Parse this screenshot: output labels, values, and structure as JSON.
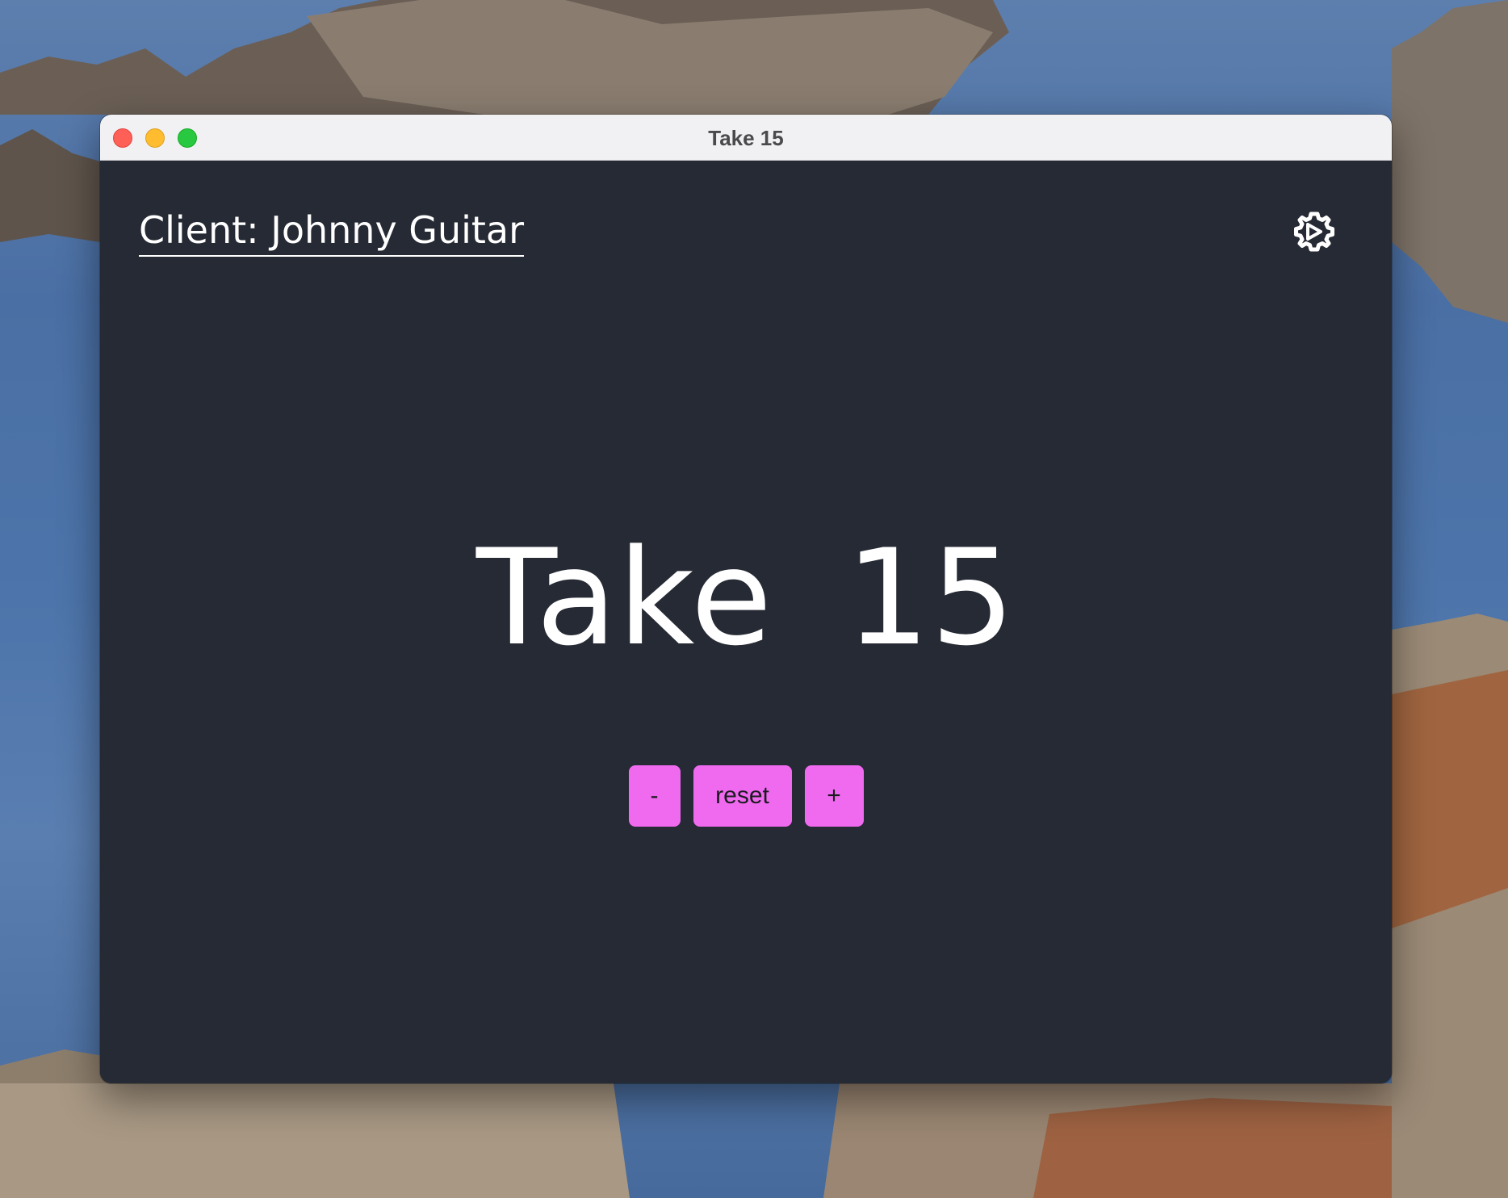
{
  "window": {
    "title": "Take 15"
  },
  "header": {
    "client_label": "Client: Johnny Guitar",
    "settings_icon": "gear-icon"
  },
  "display": {
    "take_word": "Take",
    "take_number": "15"
  },
  "controls": {
    "decrement_label": "-",
    "reset_label": "reset",
    "increment_label": "+"
  },
  "colors": {
    "content_background": "#262a34",
    "button_accent": "#f06af0",
    "text": "#ffffff"
  }
}
